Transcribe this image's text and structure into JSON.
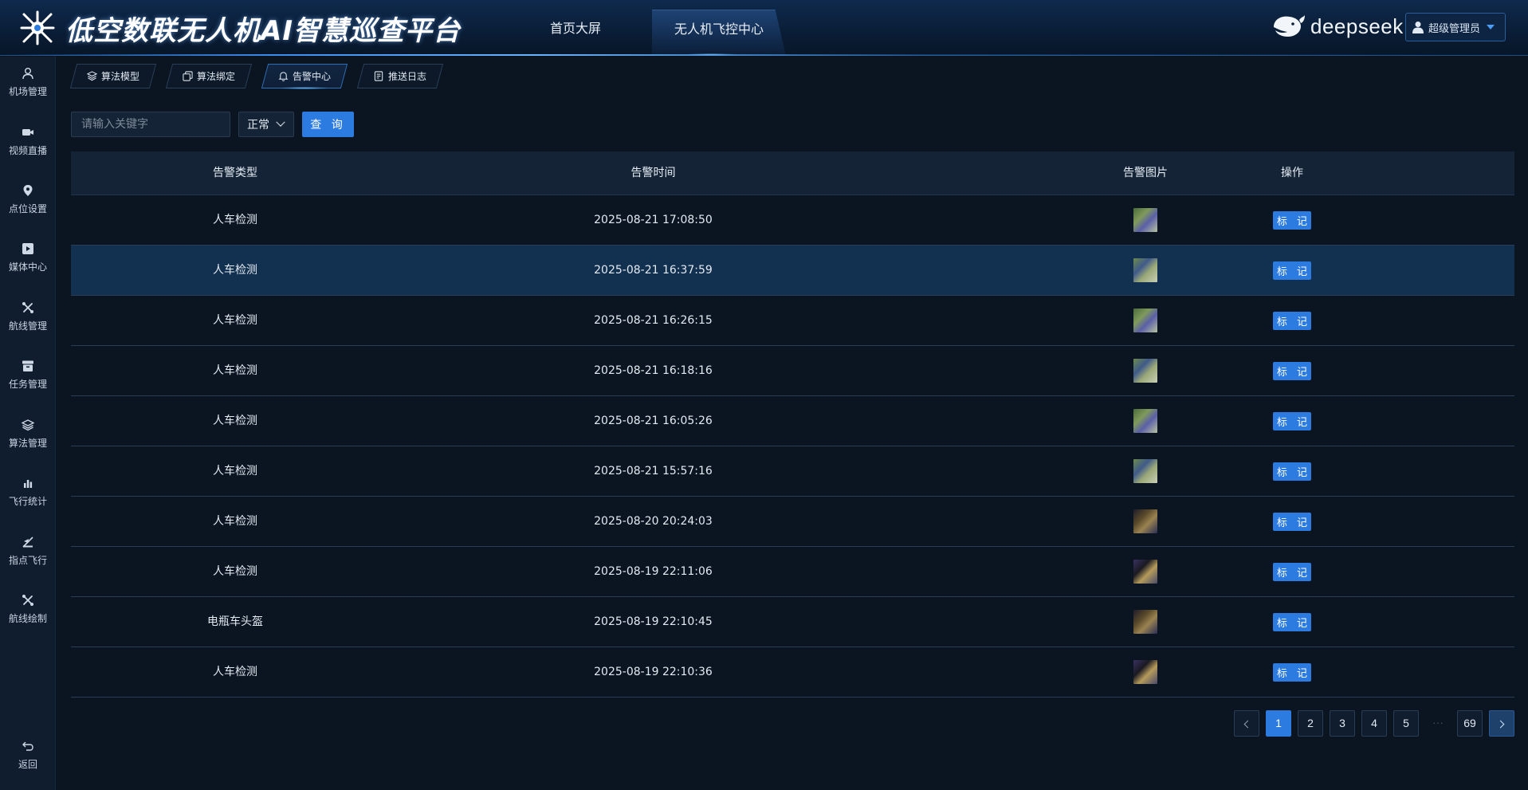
{
  "app": {
    "title": "低空数联无人机AI智慧巡查平台",
    "nav": [
      "首页大屏",
      "无人机飞控中心"
    ],
    "brand": "deepseek",
    "user": "超级管理员"
  },
  "sidebar": {
    "items": [
      {
        "label": "机场管理",
        "icon": "user-icon"
      },
      {
        "label": "视频直播",
        "icon": "video-icon"
      },
      {
        "label": "点位设置",
        "icon": "location-pin-icon"
      },
      {
        "label": "媒体中心",
        "icon": "media-play-icon"
      },
      {
        "label": "航线管理",
        "icon": "drone-icon"
      },
      {
        "label": "任务管理",
        "icon": "archive-icon"
      },
      {
        "label": "算法管理",
        "icon": "layers-icon"
      },
      {
        "label": "飞行统计",
        "icon": "bar-chart-icon"
      },
      {
        "label": "指点飞行",
        "icon": "pointer-flight-icon"
      },
      {
        "label": "航线绘制",
        "icon": "drone-icon"
      }
    ],
    "back": "返回"
  },
  "subtabs": [
    {
      "label": "算法模型",
      "icon": "layers-icon",
      "active": false
    },
    {
      "label": "算法绑定",
      "icon": "copy-icon",
      "active": false
    },
    {
      "label": "告警中心",
      "icon": "bell-icon",
      "active": true
    },
    {
      "label": "推送日志",
      "icon": "log-icon",
      "active": false
    }
  ],
  "filters": {
    "search_placeholder": "请输入关键字",
    "status": "正常",
    "query_label": "查 询"
  },
  "table": {
    "columns": [
      "告警类型",
      "告警时间",
      "告警图片",
      "操作"
    ],
    "action_label": "标 记",
    "rows": [
      {
        "type": "人车检测",
        "time": "2025-08-21 17:08:50",
        "thumb": "green"
      },
      {
        "type": "人车检测",
        "time": "2025-08-21 16:37:59",
        "thumb": "green"
      },
      {
        "type": "人车检测",
        "time": "2025-08-21 16:26:15",
        "thumb": "green"
      },
      {
        "type": "人车检测",
        "time": "2025-08-21 16:18:16",
        "thumb": "green"
      },
      {
        "type": "人车检测",
        "time": "2025-08-21 16:05:26",
        "thumb": "green"
      },
      {
        "type": "人车检测",
        "time": "2025-08-21 15:57:16",
        "thumb": "green"
      },
      {
        "type": "人车检测",
        "time": "2025-08-20 20:24:03",
        "thumb": "dark"
      },
      {
        "type": "人车检测",
        "time": "2025-08-19 22:11:06",
        "thumb": "dark"
      },
      {
        "type": "电瓶车头盔",
        "time": "2025-08-19 22:10:45",
        "thumb": "dark"
      },
      {
        "type": "人车检测",
        "time": "2025-08-19 22:10:36",
        "thumb": "dark"
      }
    ],
    "highlight_row": 1
  },
  "pagination": {
    "pages": [
      "1",
      "2",
      "3",
      "4",
      "5"
    ],
    "ellipsis": "···",
    "last": "69",
    "current": "1"
  },
  "colors": {
    "accent": "#2b7be0",
    "background": "#0b1521",
    "header": "#0a1d36",
    "row_highlight": "#12304f"
  }
}
